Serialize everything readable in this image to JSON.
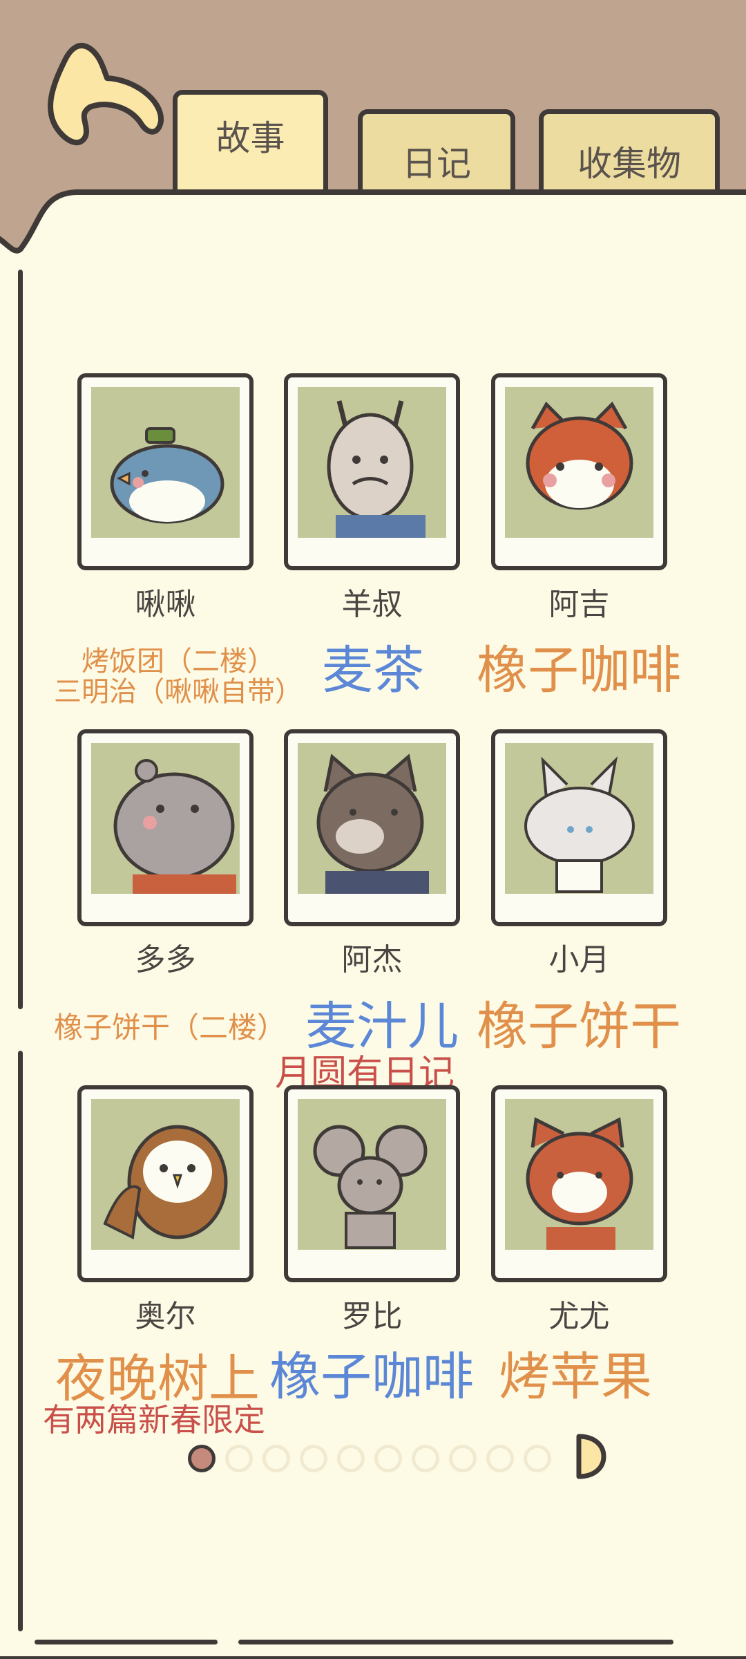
{
  "tabs": [
    {
      "label": "故事",
      "active": true
    },
    {
      "label": "日记",
      "active": false
    },
    {
      "label": "收集物",
      "active": false
    }
  ],
  "cards": [
    {
      "name": "啾啾",
      "icon": "bird-portrait-icon"
    },
    {
      "name": "羊叔",
      "icon": "goat-portrait-icon"
    },
    {
      "name": "阿吉",
      "icon": "fox-portrait-icon"
    },
    {
      "name": "多多",
      "icon": "hippo-portrait-icon"
    },
    {
      "name": "阿杰",
      "icon": "wolf-portrait-icon"
    },
    {
      "name": "小月",
      "icon": "white-cat-portrait-icon"
    },
    {
      "name": "奥尔",
      "icon": "owl-portrait-icon"
    },
    {
      "name": "罗比",
      "icon": "mouse-portrait-icon"
    },
    {
      "name": "尤尤",
      "icon": "red-panda-portrait-icon"
    }
  ],
  "notes": {
    "jiujiu_line1": "烤饭团（二楼）",
    "jiujiu_line2": "三明治（啾啾自带）",
    "yangshu": "麦茶",
    "aji": "橡子咖啡",
    "duoduo": "橡子饼干（二楼）",
    "ajie": "麦汁儿",
    "ajie_extra": "月圆有日记",
    "xiaoyue": "橡子饼干",
    "aoer": "夜晚树上",
    "luobi": "橡子咖啡",
    "youyou": "烤苹果",
    "aoer_extra": "有两篇新春限定"
  },
  "pagination": {
    "total": 10,
    "current": 1
  },
  "colors": {
    "page_bg": "#fdfbe6",
    "header_bg": "#bfa58f",
    "outline": "#3f3a38",
    "orange_note": "#e0904a",
    "blue_note": "#5b87d6",
    "red_note": "#c9504a"
  }
}
